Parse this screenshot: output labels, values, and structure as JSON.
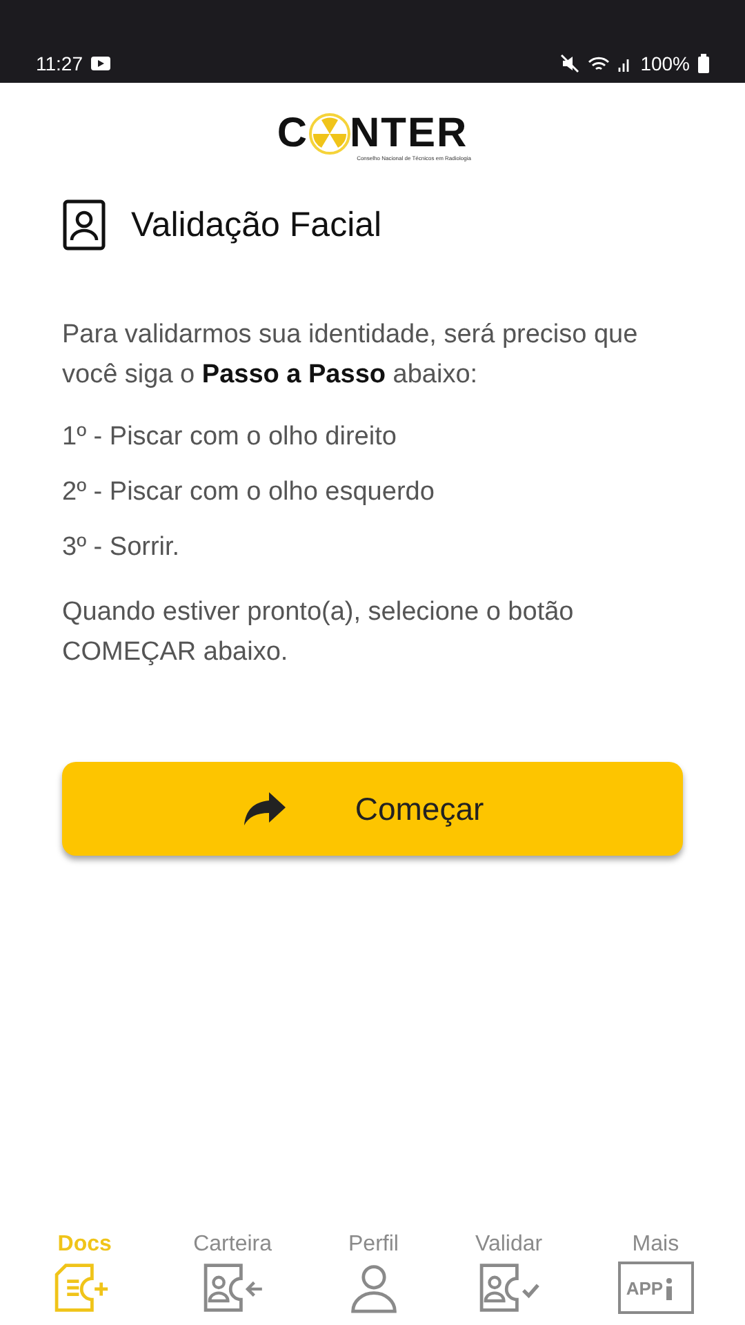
{
  "status_bar": {
    "time": "11:27",
    "battery": "100%"
  },
  "logo": {
    "first": "C",
    "rest": "NTER",
    "subtitle": "Conselho Nacional de Técnicos em Radiologia"
  },
  "title": "Validação Facial",
  "intro": "Para validarmos sua identidade, será preciso que você siga o **Passo a Passo** abaixo:",
  "steps": [
    "1º - Piscar com o olho direito",
    "2º - Piscar com o olho esquerdo",
    "3º - Sorrir."
  ],
  "outro": "Quando estiver pronto(a), selecione o botão COMEÇAR abaixo.",
  "start_button": "Começar",
  "nav": [
    {
      "label": "Docs",
      "kind": "docs",
      "selected": true
    },
    {
      "label": "Carteira",
      "kind": "wallet",
      "selected": false
    },
    {
      "label": "Perfil",
      "kind": "profile",
      "selected": false
    },
    {
      "label": "Validar",
      "kind": "validate",
      "selected": false
    },
    {
      "label": "Mais",
      "kind": "more",
      "selected": false,
      "icon_text": "APP"
    }
  ]
}
